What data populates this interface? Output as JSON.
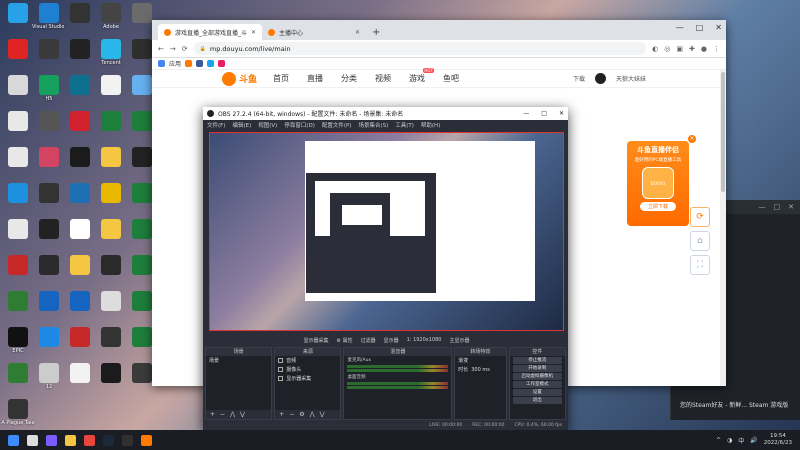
{
  "desktop": {
    "icons": [
      {
        "label": "",
        "color": "#27a2e8"
      },
      {
        "label": "Visual Studio Code",
        "color": "#1f7fd1"
      },
      {
        "label": "",
        "color": "#333333"
      },
      {
        "label": "Adobe",
        "color": "#444444"
      },
      {
        "label": "",
        "color": "#6b6b6b"
      },
      {
        "label": "",
        "color": "#e02424"
      },
      {
        "label": "",
        "color": "#3a3a3a"
      },
      {
        "label": "",
        "color": "#222222"
      },
      {
        "label": "Tencent",
        "color": "#28b7e8"
      },
      {
        "label": "",
        "color": "#2f2f2f"
      },
      {
        "label": "",
        "color": "#d8d8d8"
      },
      {
        "label": "H5",
        "color": "#16a05d"
      },
      {
        "label": "",
        "color": "#0f6f8f"
      },
      {
        "label": "",
        "color": "#f2f2f2"
      },
      {
        "label": "",
        "color": "#67b0f0"
      },
      {
        "label": "",
        "color": "#e8e8e8"
      },
      {
        "label": "",
        "color": "#555555"
      },
      {
        "label": "",
        "color": "#d1212f"
      },
      {
        "label": "",
        "color": "#1e7e3b"
      },
      {
        "label": "",
        "color": "#1e7e3b"
      },
      {
        "label": "",
        "color": "#e8e8e8"
      },
      {
        "label": "",
        "color": "#d24462"
      },
      {
        "label": "",
        "color": "#1b1b1b"
      },
      {
        "label": "",
        "color": "#f5c642"
      },
      {
        "label": "",
        "color": "#222222"
      },
      {
        "label": "",
        "color": "#1e90e0"
      },
      {
        "label": "",
        "color": "#333333"
      },
      {
        "label": "",
        "color": "#1f6fb5"
      },
      {
        "label": "",
        "color": "#e8b800"
      },
      {
        "label": "",
        "color": "#1e7e3b"
      },
      {
        "label": "",
        "color": "#e8e8e8"
      },
      {
        "label": "",
        "color": "#222222"
      },
      {
        "label": "",
        "color": "#ffffff"
      },
      {
        "label": "",
        "color": "#f5c642"
      },
      {
        "label": "",
        "color": "#1e7e3b"
      },
      {
        "label": "",
        "color": "#c62828"
      },
      {
        "label": "",
        "color": "#2a2a2a"
      },
      {
        "label": "",
        "color": "#f5c642"
      },
      {
        "label": "",
        "color": "#2a2a2a"
      },
      {
        "label": "",
        "color": "#1e7e3b"
      },
      {
        "label": "",
        "color": "#2e7d32"
      },
      {
        "label": "",
        "color": "#1565c0"
      },
      {
        "label": "",
        "color": "#1565c0"
      },
      {
        "label": "",
        "color": "#dddddd"
      },
      {
        "label": "",
        "color": "#1e7e3b"
      },
      {
        "label": "EPIC",
        "color": "#111111"
      },
      {
        "label": "",
        "color": "#1e88e5"
      },
      {
        "label": "",
        "color": "#c62828"
      },
      {
        "label": "",
        "color": "#333333"
      },
      {
        "label": "",
        "color": "#1e7e3b"
      },
      {
        "label": "",
        "color": "#2e7d32"
      },
      {
        "label": "12",
        "color": "#cccccc"
      },
      {
        "label": "",
        "color": "#f2f2f2"
      },
      {
        "label": "",
        "color": "#1b1b1b"
      },
      {
        "label": "",
        "color": "#3b3b3b"
      },
      {
        "label": "A Plague Tale",
        "color": "#333333"
      }
    ]
  },
  "browser": {
    "tabs": [
      {
        "label": "游戏直播_全部游戏直播_斗鱼直播",
        "active": true
      },
      {
        "label": "主播中心",
        "active": false
      }
    ],
    "new_tab": "+",
    "window_controls": {
      "min": "—",
      "max": "□",
      "close": "✕"
    },
    "nav": {
      "back": "←",
      "forward": "→",
      "reload": "⟳",
      "secure": "🔒"
    },
    "url": "mp.douyu.com/live/main",
    "bookmarks_label": "应用",
    "site": {
      "logo_text": "斗鱼",
      "nav": [
        "首页",
        "直播",
        "分类",
        "视频",
        "游戏",
        "鱼吧"
      ],
      "game_badge": "HOT",
      "download": "下载",
      "username": "天狼大妹妹"
    },
    "ad": {
      "title": "斗鱼直播伴侣",
      "subtitle": "超好用的PC端直播工具",
      "button": "立即下载",
      "close": "×",
      "image_label": "DOUYU"
    },
    "side_buttons": [
      "⟳",
      "⌂",
      "⛶"
    ]
  },
  "obs": {
    "title": "OBS 27.2.4 (64-bit, windows) - 配置文件: 未命名 - 场景集: 未命名",
    "window_controls": {
      "min": "—",
      "max": "□",
      "close": "✕"
    },
    "menu": [
      "文件(F)",
      "编辑(E)",
      "视图(V)",
      "停靠窗口(D)",
      "配置文件(P)",
      "场景集合(S)",
      "工具(T)",
      "帮助(H)"
    ],
    "toolbar": [
      "显示器采集",
      "⚙ 属性",
      "过滤器",
      "显示器",
      "1: 1920x1080",
      "主显示器"
    ],
    "docks": {
      "scenes": {
        "header": "场景",
        "items": [
          "场景"
        ]
      },
      "sources": {
        "header": "来源",
        "items": [
          "音频",
          "摄像头",
          "显示器采集"
        ]
      },
      "mixer": {
        "header": "混音器",
        "tracks": [
          "麦克风/Aux",
          "桌面音频"
        ]
      },
      "transitions": {
        "header": "转场特效",
        "type": "渐变",
        "duration_label": "时长",
        "duration": "300 ms"
      },
      "controls": {
        "header": "控件",
        "buttons": [
          "停止推流",
          "开始录制",
          "启动虚拟摄像机",
          "工作室模式",
          "设置",
          "退出"
        ]
      }
    },
    "status": {
      "dropped": "LIVE: 00:00:00",
      "rec": "REC: 00:00:00",
      "cpu": "CPU: 0.4%, 60.00 fps"
    }
  },
  "background_window": {
    "notify_text": "您的Steam好友 - 新鲜... Steam 游戏版",
    "controls": [
      "—",
      "□",
      "✕"
    ]
  },
  "taskbar": {
    "icons": [
      {
        "name": "start",
        "color": "#3d8bfd"
      },
      {
        "name": "search",
        "color": "#dddddd"
      },
      {
        "name": "chat",
        "color": "#7b5cff"
      },
      {
        "name": "explorer",
        "color": "#f5c642"
      },
      {
        "name": "chrome",
        "color": "#e8453c"
      },
      {
        "name": "steam",
        "color": "#1b2838"
      },
      {
        "name": "obs",
        "color": "#303030"
      },
      {
        "name": "douyu",
        "color": "#ff7a00"
      }
    ],
    "tray": [
      "^",
      "◑",
      "中",
      "🔊"
    ],
    "time": "19:54",
    "date": "2022/6/23"
  }
}
